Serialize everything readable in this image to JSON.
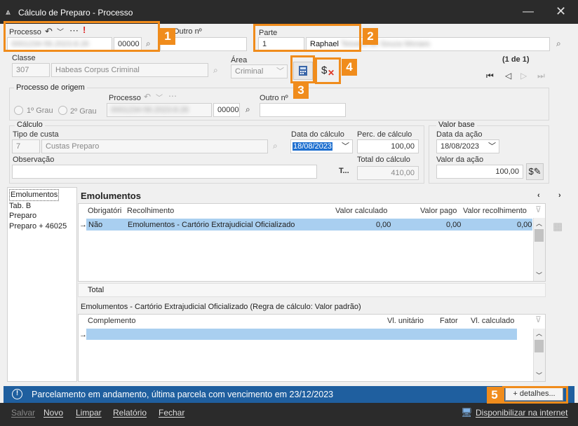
{
  "window": {
    "title": "Cálculo de Preparo - Processo"
  },
  "processo": {
    "label": "Processo",
    "value_blurred": "0001234-56.2023.8.26",
    "suffix": "00000",
    "outro_label": "Outro nº"
  },
  "parte": {
    "label": "Parte",
    "code": "1",
    "name": "Raphael",
    "name_blurred": "Teixeira de Souza Moraes"
  },
  "classe": {
    "label": "Classe",
    "code": "307",
    "name": "Habeas Corpus Criminal"
  },
  "area": {
    "label": "Área",
    "value": "Criminal"
  },
  "pager": {
    "text": "(1 de 1)"
  },
  "origem": {
    "section": "Processo de origem",
    "radio1": "1º Grau",
    "radio2": "2º Grau",
    "processo_label": "Processo",
    "value_blurred": "0001234-56.2023.8.26",
    "suffix": "00000",
    "outro_label": "Outro nº"
  },
  "calculo": {
    "section": "Cálculo",
    "tipo_label": "Tipo de custa",
    "tipo_code": "7",
    "tipo_name": "Custas Preparo",
    "data_label": "Data do cálculo",
    "data_value": "18/08/2023",
    "perc_label": "Perc. de cálculo",
    "perc_value": "100,00",
    "obs_label": "Observação",
    "obs_btn": "T...",
    "total_label": "Total do cálculo",
    "total_value": "410,00"
  },
  "valorbase": {
    "section": "Valor base",
    "data_label": "Data da ação",
    "data_value": "18/08/2023",
    "valor_label": "Valor da ação",
    "valor_value": "100,00"
  },
  "sidebar": {
    "items": [
      "Emolumentos",
      "Tab. B",
      "Preparo",
      "Preparo + 46025"
    ]
  },
  "emol": {
    "title": "Emolumentos",
    "columns": [
      "Obrigatóri",
      "Recolhimento",
      "Valor calculado",
      "Valor pago",
      "Valor recolhimento"
    ],
    "rows": [
      [
        "Não",
        "Emolumentos - Cartório Extrajudicial Oficializado",
        "0,00",
        "0,00",
        "0,00"
      ]
    ],
    "total_label": "Total"
  },
  "detail": {
    "title": "Emolumentos - Cartório Extrajudicial Oficializado (Regra de cálculo: Valor padrão)",
    "columns": [
      "Complemento",
      "Vl. unitário",
      "Fator",
      "Vl. calculado"
    ]
  },
  "status": {
    "message": "Parcelamento em andamento, última parcela com vencimento em 23/12/2023",
    "details_button": "+ detalhes..."
  },
  "bottom": {
    "salvar": "Salvar",
    "novo": "Novo",
    "limpar": "Limpar",
    "relatorio": "Relatório",
    "fechar": "Fechar",
    "disponibilizar": "Disponibilizar na internet"
  },
  "annotations": [
    "1",
    "2",
    "3",
    "4",
    "5"
  ],
  "colors": {
    "annotation": "#f08c1c",
    "status_bar": "#1f5f9f",
    "title_bar": "#2b2b2b",
    "selection": "#a9cff0"
  }
}
